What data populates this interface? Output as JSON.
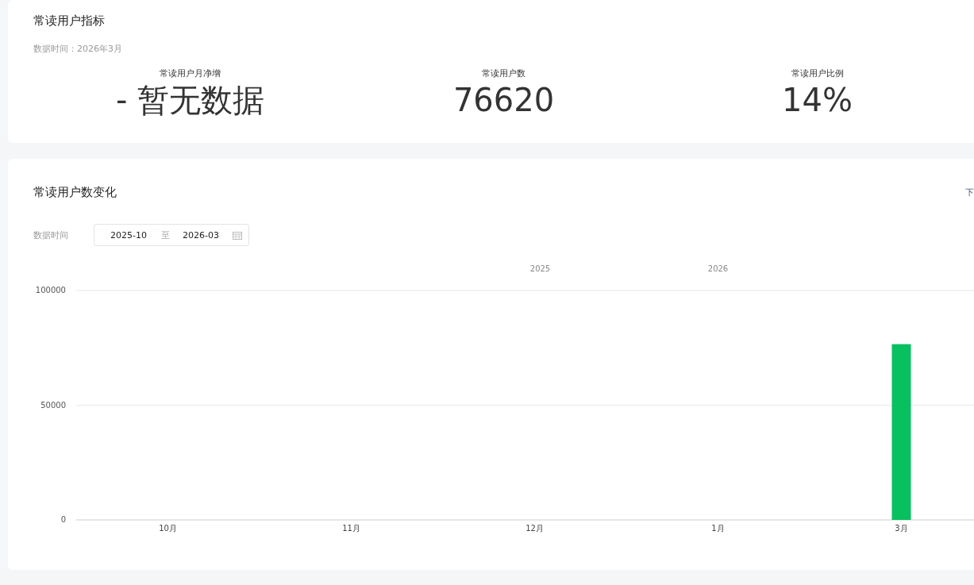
{
  "metrics_card": {
    "title": "常读用户指标",
    "data_time": "数据时间：2026年3月",
    "metrics": [
      {
        "label": "常读用户月净增",
        "value": "- 暂无数据"
      },
      {
        "label": "常读用户数",
        "value": "76620"
      },
      {
        "label": "常读用户比例",
        "value": "14%"
      }
    ]
  },
  "trend_card": {
    "title": "常读用户数变化",
    "download_link": "下",
    "date_label": "数据时间",
    "date_range": {
      "start": "2025-10",
      "separator": "至",
      "end": "2026-03"
    },
    "chart_data": {
      "type": "bar",
      "categories": [
        "10月",
        "11月",
        "12月",
        "1月",
        "3月"
      ],
      "series": [
        {
          "color": "#07c160",
          "values": [
            null,
            null,
            null,
            null,
            76620
          ]
        }
      ],
      "ylim": [
        0,
        100000
      ],
      "yticks": [
        0,
        50000,
        100000
      ],
      "annotations": [
        "2025",
        "2026"
      ]
    }
  }
}
